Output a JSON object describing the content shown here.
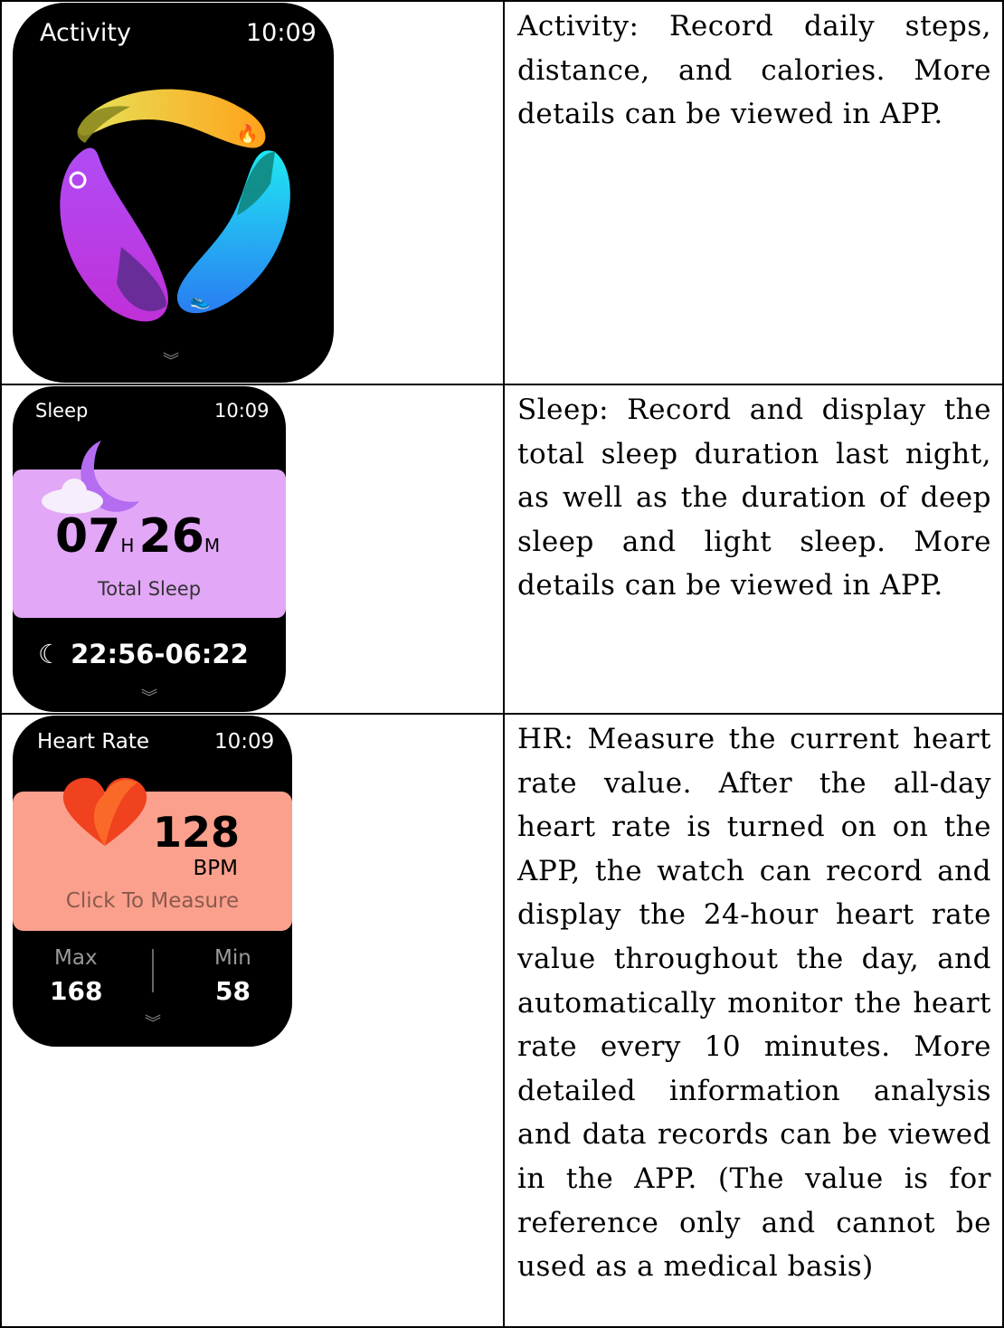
{
  "rows": [
    {
      "watch": {
        "title": "Activity",
        "time": "10:09"
      },
      "description": "Activity: Record daily steps, distance, and calories. More details can be viewed in APP."
    },
    {
      "watch": {
        "title": "Sleep",
        "time": "10:09",
        "hours": "07",
        "hours_unit": "H",
        "minutes": "26",
        "minutes_unit": "M",
        "total_label": "Total Sleep",
        "range": "22:56-06:22"
      },
      "description": "Sleep: Record and display the total sleep duration last night, as well as the duration of deep sleep and light sleep. More details can be viewed in APP."
    },
    {
      "watch": {
        "title": "Heart Rate",
        "time": "10:09",
        "value": "128",
        "unit": "BPM",
        "action": "Click To Measure",
        "max_label": "Max",
        "max_value": "168",
        "min_label": "Min",
        "min_value": "58"
      },
      "description": "HR: Measure the current heart rate value. After the all-day heart rate is turned on on the APP, the watch can record and display the 24-hour heart rate value throughout the day, and automatically monitor the heart rate every 10 minutes. More detailed information analysis and data records can be viewed in the APP. (The value is for reference only and cannot be used as a medical basis)"
    }
  ],
  "colors": {
    "sleep_card": "#e3a7f7",
    "hr_card": "#fba08d"
  }
}
